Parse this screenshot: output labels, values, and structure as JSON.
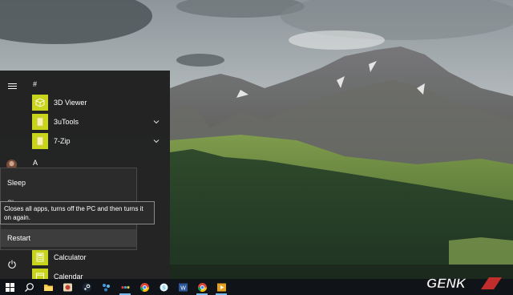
{
  "wallpaper": {
    "subject": "mountain-landscape"
  },
  "start_menu": {
    "groups": [
      {
        "header": "#",
        "apps": [
          {
            "label": "3D Viewer",
            "icon": "cube-icon",
            "expandable": false
          },
          {
            "label": "3uTools",
            "icon": "folder-icon",
            "expandable": true
          },
          {
            "label": "7-Zip",
            "icon": "folder-icon",
            "expandable": true
          }
        ]
      },
      {
        "header": "A"
      }
    ],
    "apps_lower": [
      {
        "label": "Calculator",
        "icon": "calculator-icon"
      },
      {
        "label": "Calendar",
        "icon": "calendar-icon"
      }
    ],
    "tile_color": "#c8d31c"
  },
  "power_menu": {
    "sleep": "Sleep",
    "shutdown_partial": "Sh...",
    "restart": "Restart",
    "tooltip": "Closes all apps, turns off the PC and then turns it on again."
  },
  "taskbar": {
    "icons": [
      "windows-start-icon",
      "search-icon",
      "file-explorer-icon",
      "photos-icon",
      "steam-icon",
      "network-icon",
      "dots-icon",
      "chrome-alt-icon",
      "skype-icon",
      "word-icon",
      "chrome-icon",
      "media-icon"
    ]
  },
  "watermark": {
    "text": "GENK"
  }
}
